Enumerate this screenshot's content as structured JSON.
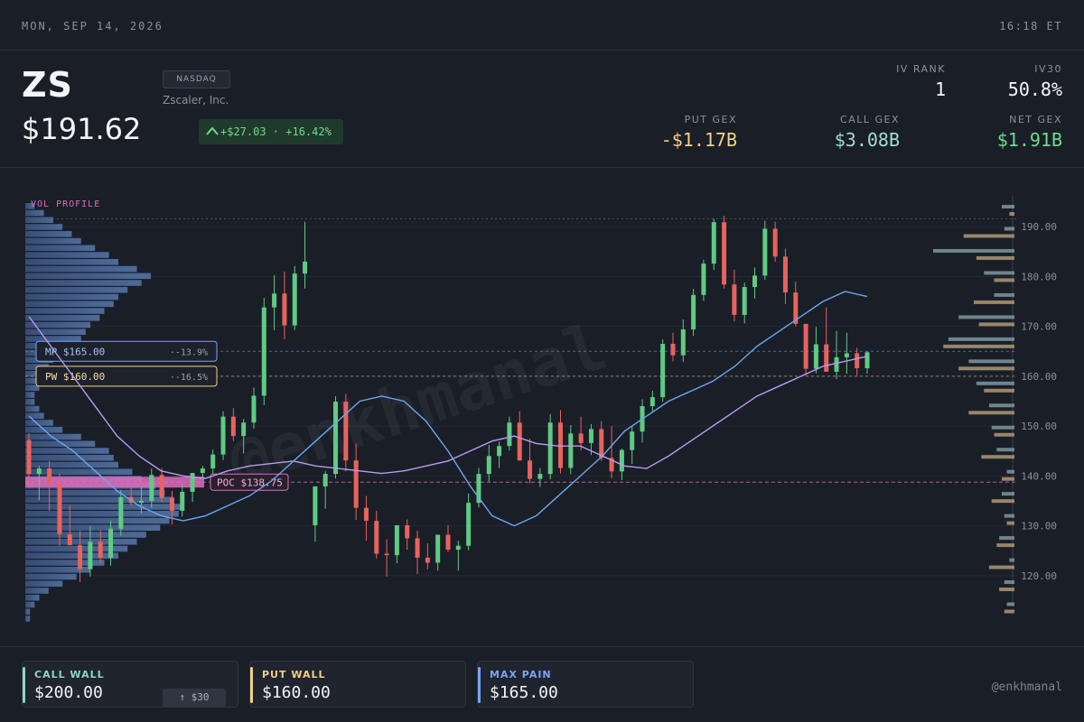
{
  "topbar": {
    "date": "MON, SEP 14, 2026",
    "time": "16:18 ET"
  },
  "header": {
    "ticker": "ZS",
    "exchange": "NASDAQ",
    "company": "Zscaler, Inc.",
    "price": "$191.62",
    "change": "+$27.03 · +16.42%",
    "change_icon": "arrow-up-icon",
    "iv_rank": {
      "label": "IV RANK",
      "value": "1"
    },
    "iv30": {
      "label": "IV30",
      "value": "50.8%"
    },
    "put_gex": {
      "label": "PUT GEX",
      "value": "-$1.17B"
    },
    "call_gex": {
      "label": "CALL GEX",
      "value": "$3.08B"
    },
    "net_gex": {
      "label": "NET GEX",
      "value": "$1.91B"
    }
  },
  "colors": {
    "up": "#5fcb82",
    "down": "#e8635e",
    "ma_fast": "#6aa8f0",
    "ma_slow": "#b79cf0",
    "call_wall": "#8fd6c6",
    "put_wall": "#f2d088",
    "max_pain": "#7aa5f5",
    "poc": "#e06cbd",
    "gex_call": "#8aa9ab",
    "gex_put": "#b8a07a"
  },
  "chart_data": {
    "type": "candlestick",
    "y_ticks": [
      190,
      180,
      170,
      160,
      150,
      140,
      130,
      120
    ],
    "y_tick_labels": [
      "190.00",
      "180.00",
      "170.00",
      "160.00",
      "150.00",
      "140.00",
      "130.00",
      "120.00"
    ],
    "ylim": [
      112,
      198
    ],
    "vol_profile_label": "VOL PROFILE",
    "poc_label": "POC $138.75",
    "poc": 138.75,
    "levels": [
      {
        "key": "mp",
        "label": "MP $165.00",
        "pct": "-13.9%",
        "value": 165
      },
      {
        "key": "pw",
        "label": "PW $160.00",
        "pct": "-16.5%",
        "value": 160
      }
    ],
    "ref_level": 191.6,
    "candles": [
      [
        147.2,
        148.6,
        138.4,
        140.4
      ],
      [
        140.4,
        142.0,
        135.1,
        141.5
      ],
      [
        141.5,
        143.0,
        133.0,
        138.5
      ],
      [
        138.5,
        140.5,
        126.0,
        128.3
      ],
      [
        128.3,
        134.0,
        126.5,
        126.1
      ],
      [
        126.1,
        129.0,
        118.7,
        121.3
      ],
      [
        121.3,
        130.0,
        119.8,
        126.8
      ],
      [
        126.8,
        129.0,
        122.6,
        123.6
      ],
      [
        123.6,
        131.0,
        122.0,
        129.4
      ],
      [
        129.4,
        137.2,
        128.0,
        135.8
      ],
      [
        135.8,
        138.0,
        134.1,
        134.6
      ],
      [
        134.6,
        137.8,
        132.5,
        135.0
      ],
      [
        135.0,
        141.5,
        133.6,
        140.2
      ],
      [
        140.2,
        141.6,
        134.8,
        135.6
      ],
      [
        135.6,
        137.0,
        130.3,
        133.0
      ],
      [
        133.0,
        138.4,
        131.8,
        136.8
      ],
      [
        136.8,
        140.1,
        134.8,
        140.6
      ],
      [
        140.6,
        142.0,
        139.5,
        141.5
      ],
      [
        141.5,
        145.3,
        140.4,
        144.3
      ],
      [
        144.3,
        153.0,
        143.2,
        151.9
      ],
      [
        151.9,
        153.6,
        147.0,
        148.0
      ],
      [
        148.0,
        151.4,
        144.5,
        150.7
      ],
      [
        150.7,
        157.7,
        149.5,
        156.1
      ],
      [
        156.1,
        175.7,
        154.2,
        173.8
      ],
      [
        173.8,
        180.3,
        169.2,
        176.6
      ],
      [
        176.6,
        181.0,
        167.4,
        170.2
      ],
      [
        170.2,
        182.1,
        169.3,
        180.6
      ],
      [
        180.6,
        191.0,
        177.6,
        183.0
      ],
      [
        130.1,
        131.3,
        126.8,
        137.9
      ],
      [
        137.9,
        141.0,
        133.4,
        140.4
      ],
      [
        140.4,
        156.0,
        139.5,
        154.9
      ],
      [
        154.9,
        156.5,
        140.9,
        143.1
      ],
      [
        143.1,
        146.5,
        131.2,
        133.6
      ],
      [
        133.6,
        136.0,
        127.0,
        131.0
      ],
      [
        131.0,
        133.0,
        123.4,
        124.4
      ],
      [
        124.4,
        127.3,
        119.8,
        124.1
      ],
      [
        124.1,
        130.0,
        122.5,
        130.1
      ],
      [
        130.1,
        131.3,
        125.2,
        127.5
      ],
      [
        127.5,
        129.0,
        120.3,
        123.6
      ],
      [
        123.6,
        126.5,
        121.3,
        122.6
      ],
      [
        122.6,
        128.0,
        121.0,
        128.2
      ],
      [
        128.2,
        130.1,
        124.8,
        125.2
      ],
      [
        125.2,
        127.0,
        121.0,
        126.0
      ],
      [
        126.0,
        136.5,
        125.1,
        134.6
      ],
      [
        134.6,
        141.6,
        133.7,
        140.4
      ],
      [
        140.4,
        146.2,
        138.9,
        144.0
      ],
      [
        144.0,
        146.9,
        141.6,
        146.0
      ],
      [
        146.0,
        151.9,
        145.1,
        150.7
      ],
      [
        150.7,
        153.0,
        144.4,
        143.1
      ],
      [
        143.1,
        147.5,
        138.5,
        139.4
      ],
      [
        139.4,
        141.6,
        137.8,
        140.4
      ],
      [
        140.4,
        152.4,
        139.3,
        150.7
      ],
      [
        150.7,
        153.2,
        140.5,
        141.6
      ],
      [
        141.6,
        150.2,
        140.4,
        148.5
      ],
      [
        148.5,
        151.9,
        145.1,
        146.6
      ],
      [
        146.6,
        150.4,
        144.2,
        149.4
      ],
      [
        149.4,
        151.0,
        143.0,
        143.6
      ],
      [
        143.6,
        150.0,
        139.5,
        140.9
      ],
      [
        140.9,
        145.5,
        139.2,
        145.2
      ],
      [
        145.2,
        150.1,
        142.4,
        148.9
      ],
      [
        148.9,
        155.4,
        146.7,
        154.0
      ],
      [
        154.0,
        157.1,
        152.7,
        155.8
      ],
      [
        155.8,
        167.4,
        154.9,
        166.5
      ],
      [
        166.5,
        168.7,
        163.0,
        164.2
      ],
      [
        164.2,
        171.4,
        162.9,
        169.4
      ],
      [
        169.4,
        177.5,
        168.1,
        176.3
      ],
      [
        176.3,
        183.4,
        175.1,
        182.6
      ],
      [
        182.6,
        191.6,
        181.3,
        190.9
      ],
      [
        190.9,
        192.2,
        177.6,
        178.4
      ],
      [
        178.4,
        181.4,
        171.0,
        172.3
      ],
      [
        172.3,
        178.8,
        170.6,
        177.9
      ],
      [
        177.9,
        181.8,
        175.6,
        180.2
      ],
      [
        180.2,
        191.2,
        179.3,
        189.6
      ],
      [
        189.6,
        191.0,
        183.0,
        184.0
      ],
      [
        184.0,
        185.6,
        174.5,
        176.8
      ],
      [
        176.8,
        179.0,
        170.0,
        170.5
      ],
      [
        170.5,
        167.0,
        160.2,
        161.5
      ],
      [
        161.5,
        169.9,
        160.6,
        166.4
      ],
      [
        166.4,
        173.8,
        163.8,
        160.9
      ],
      [
        160.9,
        169.1,
        159.4,
        163.8
      ],
      [
        163.8,
        168.7,
        160.5,
        164.6
      ],
      [
        164.6,
        165.7,
        160.2,
        161.6
      ],
      [
        161.6,
        165.0,
        160.5,
        164.8
      ]
    ],
    "ma_fast": [
      152,
      148,
      145,
      141,
      137,
      134,
      132,
      131,
      132,
      134,
      136,
      139,
      143,
      147,
      151,
      155,
      156,
      155,
      151,
      145,
      138,
      132,
      130,
      132,
      136,
      140,
      144,
      149,
      152,
      155,
      157,
      159,
      162,
      166,
      169,
      172,
      175,
      177,
      176
    ],
    "ma_slow": [
      172,
      166,
      160,
      154,
      148,
      144,
      141,
      140,
      139.5,
      141,
      142,
      142.5,
      143,
      142,
      141.5,
      141,
      140.5,
      141,
      142,
      143,
      145,
      147,
      148,
      146.5,
      146,
      146,
      144,
      142,
      141.5,
      144,
      147,
      150,
      153,
      156,
      158,
      160,
      162,
      163,
      164
    ],
    "vol_profile": [
      2,
      4,
      6,
      8,
      10,
      12,
      15,
      18,
      20,
      24,
      27,
      25,
      22,
      20,
      19,
      17,
      16,
      14,
      13,
      12,
      10,
      8,
      6,
      5,
      4,
      3,
      3,
      2,
      2,
      3,
      4,
      6,
      8,
      12,
      15,
      18,
      19,
      20,
      23,
      25,
      28,
      30,
      32,
      34,
      33,
      31,
      29,
      26,
      24,
      22,
      20,
      17,
      14,
      11,
      8,
      5,
      3,
      2,
      1,
      1
    ],
    "gex_call": [
      5,
      4,
      32,
      12,
      8,
      22,
      26,
      18,
      15,
      10,
      9,
      7,
      3,
      5,
      4,
      6,
      2,
      4,
      3
    ],
    "gex_put": [
      2,
      20,
      15,
      8,
      16,
      14,
      28,
      22,
      12,
      18,
      8,
      13,
      5,
      9,
      3,
      7,
      10,
      6,
      4
    ]
  },
  "footer": {
    "call_wall": {
      "label": "CALL WALL",
      "value": "$200.00",
      "pill": "↑ $30"
    },
    "put_wall": {
      "label": "PUT WALL",
      "value": "$160.00"
    },
    "max_pain": {
      "label": "MAX PAIN",
      "value": "$165.00"
    },
    "handle": "@enkhmanal",
    "watermark": "@enkhmanal"
  }
}
